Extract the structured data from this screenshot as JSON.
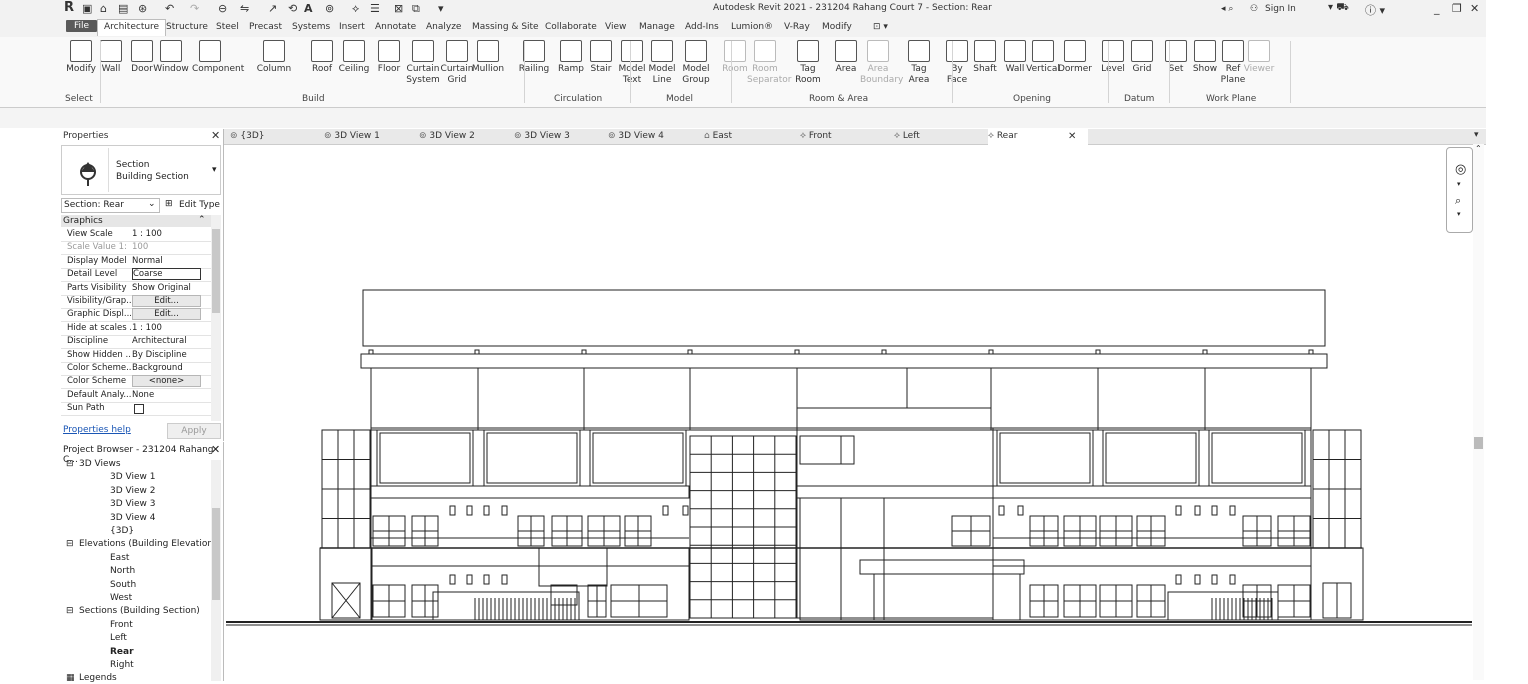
{
  "title": "Autodesk Revit 2021 - 231204 Rahang Court 7 - Section: Rear",
  "account": {
    "sign_in": "Sign In"
  },
  "ribbon_tabs": [
    "File",
    "Architecture",
    "Structure",
    "Steel",
    "Precast",
    "Systems",
    "Insert",
    "Annotate",
    "Analyze",
    "Massing & Site",
    "Collaborate",
    "View",
    "Manage",
    "Add-Ins",
    "Lumion®",
    "V-Ray",
    "Modify"
  ],
  "ribbon_tools": [
    {
      "label": "Modify",
      "label2": "",
      "icon": "cursor-icon"
    },
    {
      "label": "Wall",
      "label2": "",
      "icon": "wall-icon"
    },
    {
      "label": "Door",
      "label2": "",
      "icon": "door-icon"
    },
    {
      "label": "Window",
      "label2": "",
      "icon": "window-icon"
    },
    {
      "label": "Component",
      "label2": "",
      "icon": "component-icon"
    },
    {
      "label": "Column",
      "label2": "",
      "icon": "column-icon"
    },
    {
      "label": "Roof",
      "label2": "",
      "icon": "roof-icon"
    },
    {
      "label": "Ceiling",
      "label2": "",
      "icon": "ceiling-icon"
    },
    {
      "label": "Floor",
      "label2": "",
      "icon": "floor-icon"
    },
    {
      "label": "Curtain",
      "label2": "System",
      "icon": "curtain-system-icon"
    },
    {
      "label": "Curtain",
      "label2": "Grid",
      "icon": "curtain-grid-icon"
    },
    {
      "label": "Mullion",
      "label2": "",
      "icon": "mullion-icon"
    },
    {
      "label": "Railing",
      "label2": "",
      "icon": "railing-icon"
    },
    {
      "label": "Ramp",
      "label2": "",
      "icon": "ramp-icon"
    },
    {
      "label": "Stair",
      "label2": "",
      "icon": "stair-icon"
    },
    {
      "label": "Model",
      "label2": "Text",
      "icon": "model-text-icon"
    },
    {
      "label": "Model",
      "label2": "Line",
      "icon": "model-line-icon"
    },
    {
      "label": "Model",
      "label2": "Group",
      "icon": "model-group-icon"
    },
    {
      "label": "Room",
      "label2": "",
      "icon": "room-icon",
      "dim": true
    },
    {
      "label": "Room",
      "label2": "Separator",
      "icon": "room-separator-icon",
      "dim": true
    },
    {
      "label": "Tag",
      "label2": "Room",
      "icon": "tag-room-icon"
    },
    {
      "label": "Area",
      "label2": "",
      "icon": "area-icon"
    },
    {
      "label": "Area",
      "label2": "Boundary",
      "icon": "area-boundary-icon",
      "dim": true
    },
    {
      "label": "Tag",
      "label2": "Area",
      "icon": "tag-area-icon"
    },
    {
      "label": "By",
      "label2": "Face",
      "icon": "by-face-icon"
    },
    {
      "label": "Shaft",
      "label2": "",
      "icon": "shaft-icon"
    },
    {
      "label": "Wall",
      "label2": "",
      "icon": "wall-opening-icon"
    },
    {
      "label": "Vertical",
      "label2": "",
      "icon": "vertical-icon"
    },
    {
      "label": "Dormer",
      "label2": "",
      "icon": "dormer-icon"
    },
    {
      "label": "Level",
      "label2": "",
      "icon": "level-icon"
    },
    {
      "label": "Grid",
      "label2": "",
      "icon": "grid-icon"
    },
    {
      "label": "Set",
      "label2": "",
      "icon": "set-icon"
    },
    {
      "label": "Show",
      "label2": "",
      "icon": "show-icon"
    },
    {
      "label": "Ref",
      "label2": "Plane",
      "icon": "ref-plane-icon"
    },
    {
      "label": "Viewer",
      "label2": "",
      "icon": "viewer-icon",
      "dim": true
    }
  ],
  "ribbon_panels": [
    "Select",
    "Build",
    "Circulation",
    "Model",
    "Room & Area",
    "Opening",
    "Datum",
    "Work Plane"
  ],
  "view_tabs": [
    "{3D}",
    "3D View 1",
    "3D View 2",
    "3D View 3",
    "3D View 4",
    "East",
    "Front",
    "Left",
    "Rear"
  ],
  "properties": {
    "title": "Properties",
    "type_line1": "Section",
    "type_line2": "Building Section",
    "selector": "Section: Rear",
    "edit_type": "Edit Type",
    "group": "Graphics",
    "rows": [
      {
        "k": "View Scale",
        "v": "1 : 100"
      },
      {
        "k": "Scale Value    1:",
        "v": "100"
      },
      {
        "k": "Display Model",
        "v": "Normal"
      },
      {
        "k": "Detail Level",
        "v": "Coarse"
      },
      {
        "k": "Parts Visibility",
        "v": "Show Original"
      },
      {
        "k": "Visibility/Grap...",
        "v": "Edit..."
      },
      {
        "k": "Graphic Displ...",
        "v": "Edit..."
      },
      {
        "k": "Hide at scales ...",
        "v": "1 : 100"
      },
      {
        "k": "Discipline",
        "v": "Architectural"
      },
      {
        "k": "Show Hidden ...",
        "v": "By Discipline"
      },
      {
        "k": "Color Scheme...",
        "v": "Background"
      },
      {
        "k": "Color Scheme",
        "v": "<none>"
      },
      {
        "k": "Default Analy...",
        "v": "None"
      },
      {
        "k": "Sun Path",
        "v": ""
      }
    ],
    "help": "Properties help",
    "apply": "Apply"
  },
  "browser": {
    "title": "Project Browser - 231204 Rahang C...",
    "items": [
      {
        "t": "3D Views",
        "lvl": 0
      },
      {
        "t": "3D View 1",
        "lvl": 1
      },
      {
        "t": "3D View 2",
        "lvl": 1
      },
      {
        "t": "3D View 3",
        "lvl": 1
      },
      {
        "t": "3D View 4",
        "lvl": 1
      },
      {
        "t": "{3D}",
        "lvl": 1
      },
      {
        "t": "Elevations (Building Elevation",
        "lvl": 0
      },
      {
        "t": "East",
        "lvl": 1
      },
      {
        "t": "North",
        "lvl": 1
      },
      {
        "t": "South",
        "lvl": 1
      },
      {
        "t": "West",
        "lvl": 1
      },
      {
        "t": "Sections (Building Section)",
        "lvl": 0
      },
      {
        "t": "Front",
        "lvl": 1
      },
      {
        "t": "Left",
        "lvl": 1
      },
      {
        "t": "Rear",
        "lvl": 1,
        "bold": true
      },
      {
        "t": "Right",
        "lvl": 1
      },
      {
        "t": "Legends",
        "lvl": 0
      }
    ]
  }
}
